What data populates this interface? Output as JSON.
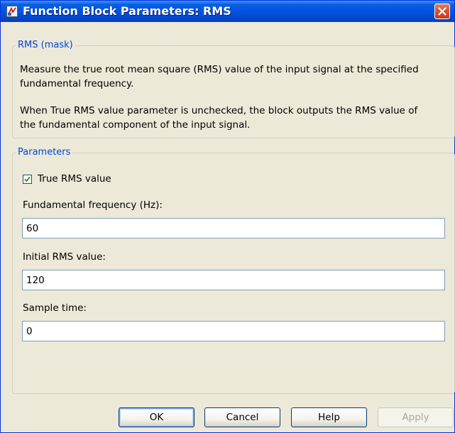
{
  "window": {
    "title": "Function Block Parameters: RMS"
  },
  "mask": {
    "legend": "RMS (mask)",
    "description_line1": "Measure the true root mean square (RMS) value of the input signal at the specified",
    "description_line2": "fundamental frequency.",
    "description_line3": "When True RMS value parameter is unchecked, the block outputs the RMS value of",
    "description_line4": "the fundamental component of the input signal."
  },
  "parameters": {
    "legend": "Parameters",
    "true_rms": {
      "label": "True RMS value",
      "checked": true
    },
    "fundamental_frequency": {
      "label": "Fundamental frequency (Hz):",
      "value": "60"
    },
    "initial_rms": {
      "label": "Initial RMS value:",
      "value": "120"
    },
    "sample_time": {
      "label": "Sample time:",
      "value": "0"
    }
  },
  "buttons": {
    "ok": "OK",
    "cancel": "Cancel",
    "help": "Help",
    "apply": "Apply"
  },
  "colors": {
    "title_bar": "#0054e3",
    "group_legend": "#0046d5",
    "dialog_background": "#ece9d8",
    "close_button": "#d7502c"
  }
}
